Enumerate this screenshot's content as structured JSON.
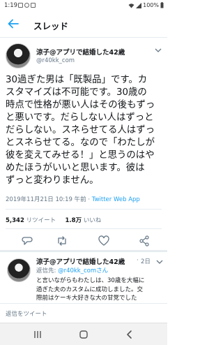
{
  "status_bar": {
    "time": "1:19",
    "battery": "100%"
  },
  "header": {
    "title": "スレッド"
  },
  "tweet": {
    "author_name": "涼子@アプリで結婚した42歳",
    "author_handle": "@r40kk_com",
    "text": "30過ぎた男は「既製品」です。カ\nスタマイズは不可能です。30歳の\n時点で性格が悪い人はその後もずっ\nと悪いです。だらしない人はずっと\nだらしない。スネらせてる人はずっ\nとスネらせてる。なので「わたしが\n彼を変えてみせる！」と思うのはや\nめたほうがいいと思います。彼は\nずっと変わりません。",
    "timestamp": "2019年11月21日 10:19 午前",
    "separator": " · ",
    "client": "Twitter Web App",
    "retweets_count": "5,342",
    "retweets_label": "リツイート",
    "likes_count": "1.8万",
    "likes_label": "いいね"
  },
  "reply": {
    "author_name": "涼子@アプリで結婚した42歳",
    "dot": "·",
    "date": "2日",
    "reply_to_label": "返信先:",
    "reply_to_mention": "@r40kk_comさん",
    "text": "と言いながらもわたしは、30歳を大幅に\n過ぎた夫のカスタムに成功しました。交\n際前はケーキ大好きな大の甘党でした"
  },
  "compose": {
    "placeholder": "返信をツイート"
  },
  "icons": {
    "back": "back-arrow-icon",
    "caret": "chevron-down-icon",
    "reply": "reply-icon",
    "retweet": "retweet-icon",
    "like": "heart-icon",
    "share": "share-icon"
  },
  "colors": {
    "accent": "#1da1f2",
    "muted": "#657786",
    "text": "#14171a"
  }
}
